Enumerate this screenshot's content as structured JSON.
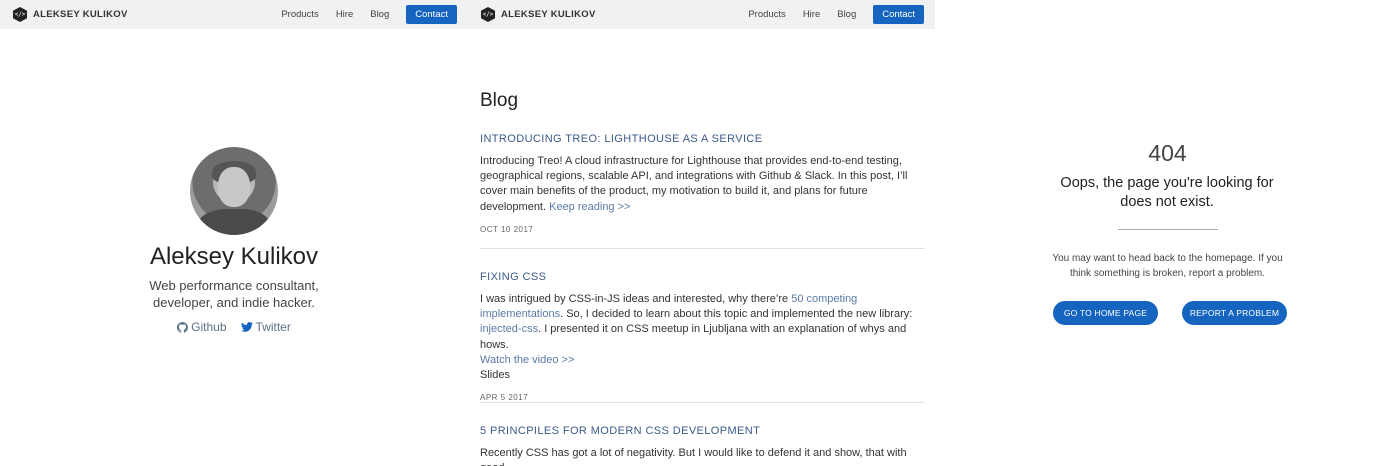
{
  "nav": {
    "brand": "ALEKSEY KULIKOV",
    "logo_glyph": "</>",
    "links": [
      "Products",
      "Hire",
      "Blog"
    ],
    "contact": "Contact",
    "accent": "#1565c0"
  },
  "profile": {
    "name": "Aleksey Kulikov",
    "tagline": "Web performance consultant, developer, and indie hacker.",
    "github": "Github",
    "twitter": "Twitter"
  },
  "blog": {
    "title": "Blog",
    "posts": [
      {
        "title": "INTRODUCING TREO: LIGHTHOUSE AS A SERVICE",
        "body": "Introducing Treo! A cloud infrastructure for Lighthouse that provides end-to-end testing, geographical regions, scalable API, and integrations with Github & Slack. In this post, I’ll cover main benefits of the product, my motivation to build it, and plans for future development.",
        "more": "Keep reading >>",
        "date": "OCT 10 2017"
      },
      {
        "title": "FIXING CSS",
        "body_1": "I was intrigued by CSS-in-JS ideas and interested, why there’re",
        "link_1": "50 competing implementations",
        "body_2": ". So, I decided to learn about this topic and implemented the new library:",
        "link_2": "injected-css",
        "body_3": ". I presented it on CSS meetup in Ljubljana with an explanation of whys and hows.",
        "link_3": "Watch the video >>",
        "extra": "Slides",
        "date": "APR 5 2017"
      },
      {
        "title": "5 PRINCPILES FOR MODERN CSS DEVELOPMENT",
        "body": "Recently CSS has got a lot of negativity. But I would like to defend it and show, that with good"
      }
    ]
  },
  "notfound": {
    "code": "404",
    "headline": "Oops, the page you're looking for does not exist.",
    "message": "You may want to head back to the homepage. If you think something is broken, report a problem.",
    "home_button": "GO TO HOME PAGE",
    "report_button": "REPORT A PROBLEM"
  }
}
